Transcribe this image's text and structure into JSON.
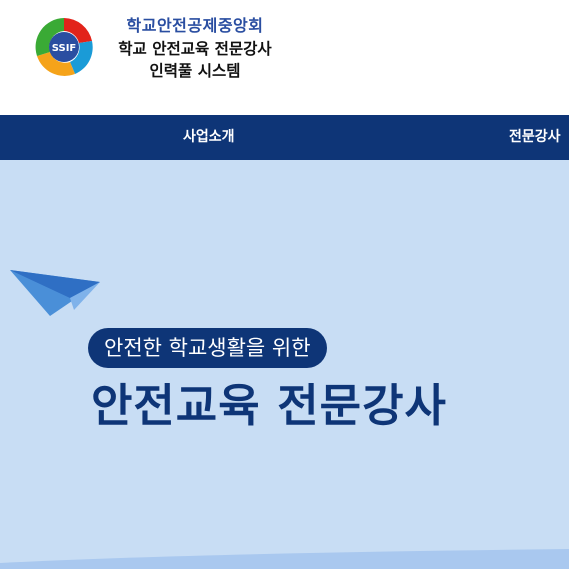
{
  "header": {
    "org_name": "학교안전공제중앙회",
    "system_title_line1": "학교 안전교육 전문강사",
    "system_title_line2": "인력풀 시스템",
    "logo": {
      "icon": "ssif-logo-icon",
      "text": "SSIF"
    }
  },
  "nav": {
    "items": [
      {
        "label": "사업소개"
      },
      {
        "label": "전문강사"
      }
    ]
  },
  "hero": {
    "subtitle": "안전한 학교생활을 위한",
    "headline": "안전교육 전문강사",
    "plane_icon": "paper-plane-icon"
  },
  "colors": {
    "navy": "#0e3577",
    "brand_blue": "#2a4ea1",
    "hero_bg": "#c8ddf4"
  }
}
